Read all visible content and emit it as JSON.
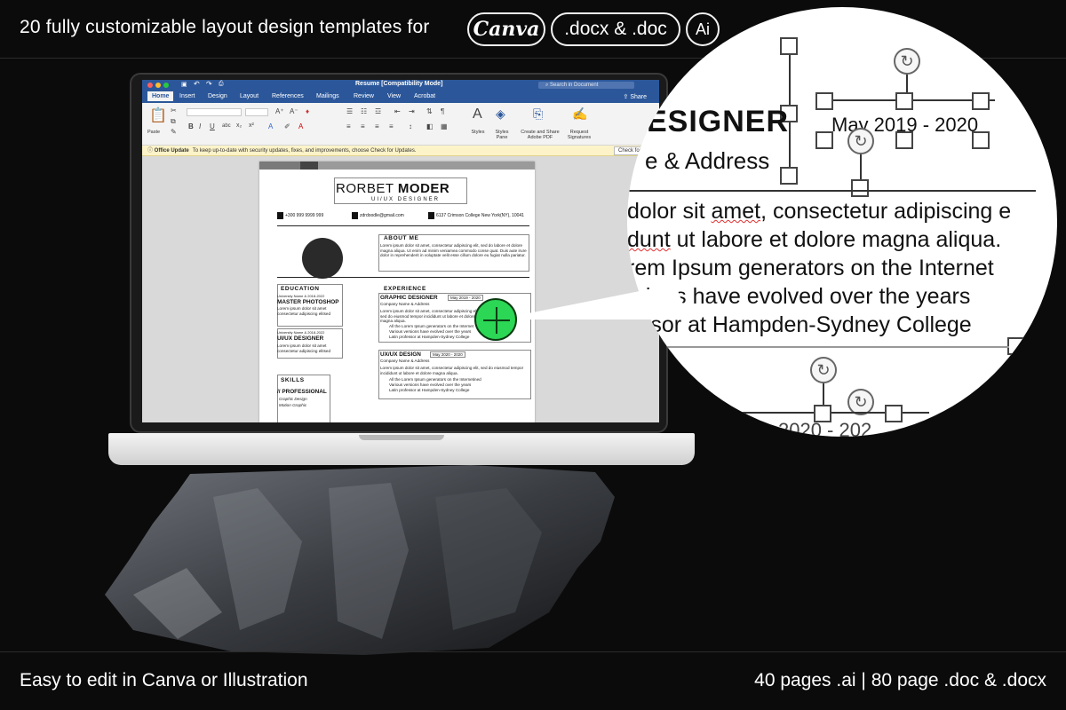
{
  "header": {
    "headline": "20 fully customizable layout design templates for",
    "badges": {
      "canva": "Canva",
      "docx": ".docx & .doc",
      "ai": "Ai"
    }
  },
  "footer": {
    "left": "Easy to edit in Canva or Illustration",
    "right": "40 pages .ai | 80 page .doc & .docx"
  },
  "word": {
    "title": "Resume [Compatibility Mode]",
    "search_placeholder": "Search in Document",
    "tabs": [
      "Home",
      "Insert",
      "Design",
      "Layout",
      "References",
      "Mailings",
      "Review",
      "View",
      "Acrobat"
    ],
    "share_label": "Share",
    "ribbon": {
      "paste": "Paste",
      "styles": "Styles",
      "styles_pane": "Styles Pane",
      "create_pdf": "Create and Share Adobe PDF",
      "request_sign": "Request Signatures"
    },
    "update_bar": {
      "label": "Office Update",
      "message": "To keep up-to-date with security updates, fixes, and improvements, choose Check for Updates.",
      "button": "Check for Up"
    }
  },
  "resume": {
    "name_first": "RORBET ",
    "name_last": "MODER",
    "role": "UI/UX DESIGNER",
    "phone": "+300 999 9999 999",
    "email": "zdrdoodle@gmail.com",
    "address": "6137 Crimson College New York(NY), 10041",
    "about_title": "ABOUT ME",
    "about_text": "Lorem ipsum dolor sit amet, consectetur adipiscing elit, sed do labore et dolore magna aliqua. Ut enim ad minim veniamea commodo conse quat. Duis aute irure dolor in reprehenderit in voluptate velit esse cillum dolore eu fugiat nulla pariatur.",
    "education_title": "EDUCATION",
    "edu1_meta": "University Name & 2018-2022",
    "edu1_title": "MASTER PHOTOSHOP",
    "edu1_text": "Lorem ipsum dolor sit amet consectetur adipiscing elitsed",
    "edu2_meta": "University Name & 2018-2022",
    "edu2_title": "UI/UX DESIGNER",
    "edu2_text": "Lorem ipsum dolor sit amet consectetur adipiscing elitsed",
    "skills_title": "SKILLS",
    "skills_sub": "// PROFESSIONAL",
    "skill1": "Graphic Design",
    "skill2": "Motion Graphic",
    "experience_title": "EXPERIENCE",
    "exp1_title": "GRAPHIC DESIGNER",
    "exp1_date": "May 2019 - 2020",
    "exp1_company": "Company Name & Address",
    "exp1_text": "Lorem ipsum dolor sit amet, consectetur adipiscing elit, sed do eiusmod tempor incididunt ut labore et dolore magna aliqua.",
    "exp1_b1": "All the Lorem Ipsum generators on the Internet",
    "exp1_b2": "Various versions have evolved over the years",
    "exp1_b3": "Latin professor at Hampden-Sydney College",
    "exp2_title": "UX/UX DESIGN",
    "exp2_date": "May 2020 - 2020",
    "exp2_company": "Company Name & Address",
    "exp2_text": "Lorem ipsum dolor sit amet, consectetur adipiscing elit, sed do eiusmod tempor incididunt ut labore et dolore magna aliqua.",
    "exp2_b1": "All the Lorem Ipsum generators on the Internetined",
    "exp2_b2": "Various versions have evolved over the years",
    "exp2_b3": "Latin professor at Hampden-Sydney College"
  },
  "magnifier": {
    "heading": "ESIGNER",
    "date": "May 2019 - 2020",
    "sub": "e & Address",
    "line1_a": "dolor sit ",
    "line1_b": "amet",
    "line1_c": ", consectetur adipiscing e",
    "line2_a": "dunt",
    "line2_b": " ut labore et dolore magna aliqua.",
    "line3": "rem Ipsum generators on the Internet",
    "line4": "rsions have evolved over the years",
    "line5": "essor at Hampden-Sydney College",
    "line6": "2020 - 202"
  },
  "colors": {
    "background": "#0b0b0b",
    "word_blue": "#2b579a",
    "green_accent": "#2bd755",
    "update_bar": "#fcf3c9"
  },
  "icons": [
    "plus-icon",
    "rotate-icon",
    "close-icon",
    "save-icon",
    "undo-icon",
    "redo-icon",
    "print-icon",
    "share-icon",
    "search-icon",
    "phone-icon",
    "mail-icon",
    "location-icon"
  ]
}
